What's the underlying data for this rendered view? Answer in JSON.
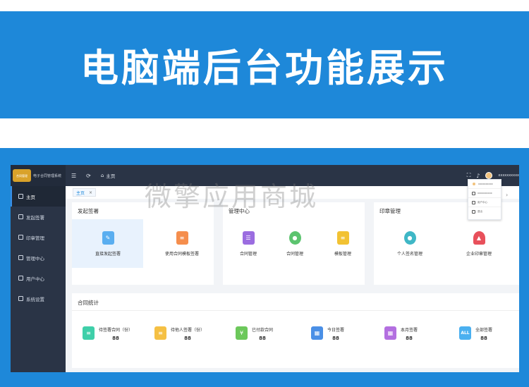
{
  "banner": {
    "title": "电脑端后台功能展示"
  },
  "app": {
    "logo_badge": "合同管理",
    "logo_text": "电子合同管理系统",
    "topbar": {
      "menu_icon": "☰",
      "refresh_icon": "⟳",
      "home_label": "主页",
      "user": "xxxxxxxxxx"
    },
    "sidebar": [
      {
        "label": "主页"
      },
      {
        "label": "发起签署"
      },
      {
        "label": "印章管理"
      },
      {
        "label": "管理中心"
      },
      {
        "label": "用户中心"
      },
      {
        "label": "系统设置"
      }
    ],
    "tab_home": "主页",
    "tab_close": "×",
    "sections": {
      "sign": {
        "title": "发起签署",
        "items": [
          "直接发起签署",
          "使用合同模板签署"
        ]
      },
      "manage": {
        "title": "管理中心",
        "items": [
          "合同管理",
          "合同管理",
          "模板管理"
        ]
      },
      "seal": {
        "title": "印章管理",
        "items": [
          "个人签名管理",
          "企业印章管理"
        ]
      }
    },
    "stats": {
      "title": "合同统计",
      "items": [
        {
          "label": "待签署合同（份）",
          "value": "88"
        },
        {
          "label": "待他人签署（份）",
          "value": "88"
        },
        {
          "label": "已付款合同",
          "value": "88"
        },
        {
          "label": "今日签署",
          "value": "88"
        },
        {
          "label": "本月签署",
          "value": "88"
        },
        {
          "label": "全部签署",
          "value": "88"
        }
      ]
    },
    "dropdown": [
      "xxxxxxxxxx",
      "xxxxxxxxxx",
      "用户中心",
      "退出"
    ]
  },
  "watermark": "微擎应用商城",
  "colors": {
    "accent": "#1e88d9",
    "sidebar": "#2a3446"
  }
}
